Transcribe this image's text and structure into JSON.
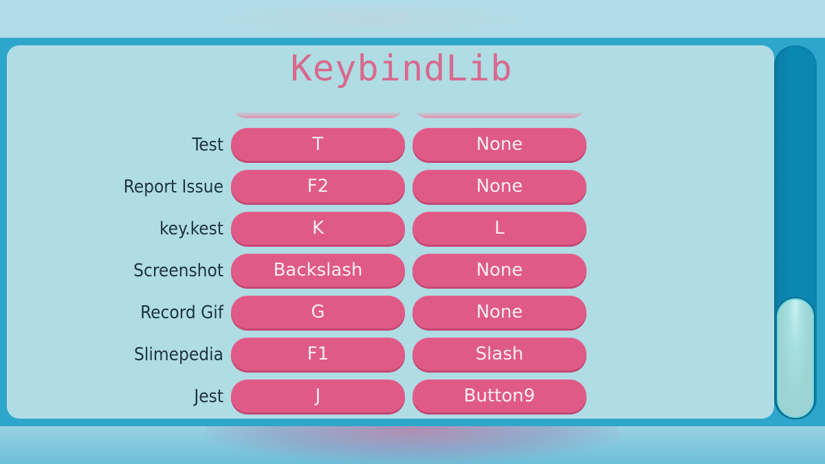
{
  "window": {
    "title": "KeybindLib"
  },
  "colors": {
    "accent_pill": "#e05a88",
    "title_text": "#d86a8e",
    "panel_bg": "#b0dce4",
    "frame": "#2ea6cc",
    "scroll_track": "#0a88b3",
    "scroll_thumb": "#9dd4d3"
  },
  "keybinds": [
    {
      "action": "Test",
      "primary": "T",
      "secondary": "None"
    },
    {
      "action": "Report Issue",
      "primary": "F2",
      "secondary": "None"
    },
    {
      "action": "key.kest",
      "primary": "K",
      "secondary": "L"
    },
    {
      "action": "Screenshot",
      "primary": "Backslash",
      "secondary": "None"
    },
    {
      "action": "Record Gif",
      "primary": "G",
      "secondary": "None"
    },
    {
      "action": "Slimepedia",
      "primary": "F1",
      "secondary": "Slash"
    },
    {
      "action": "Jest",
      "primary": "J",
      "secondary": "Button9"
    }
  ],
  "scrollbar": {
    "position_fraction": 1.0
  }
}
